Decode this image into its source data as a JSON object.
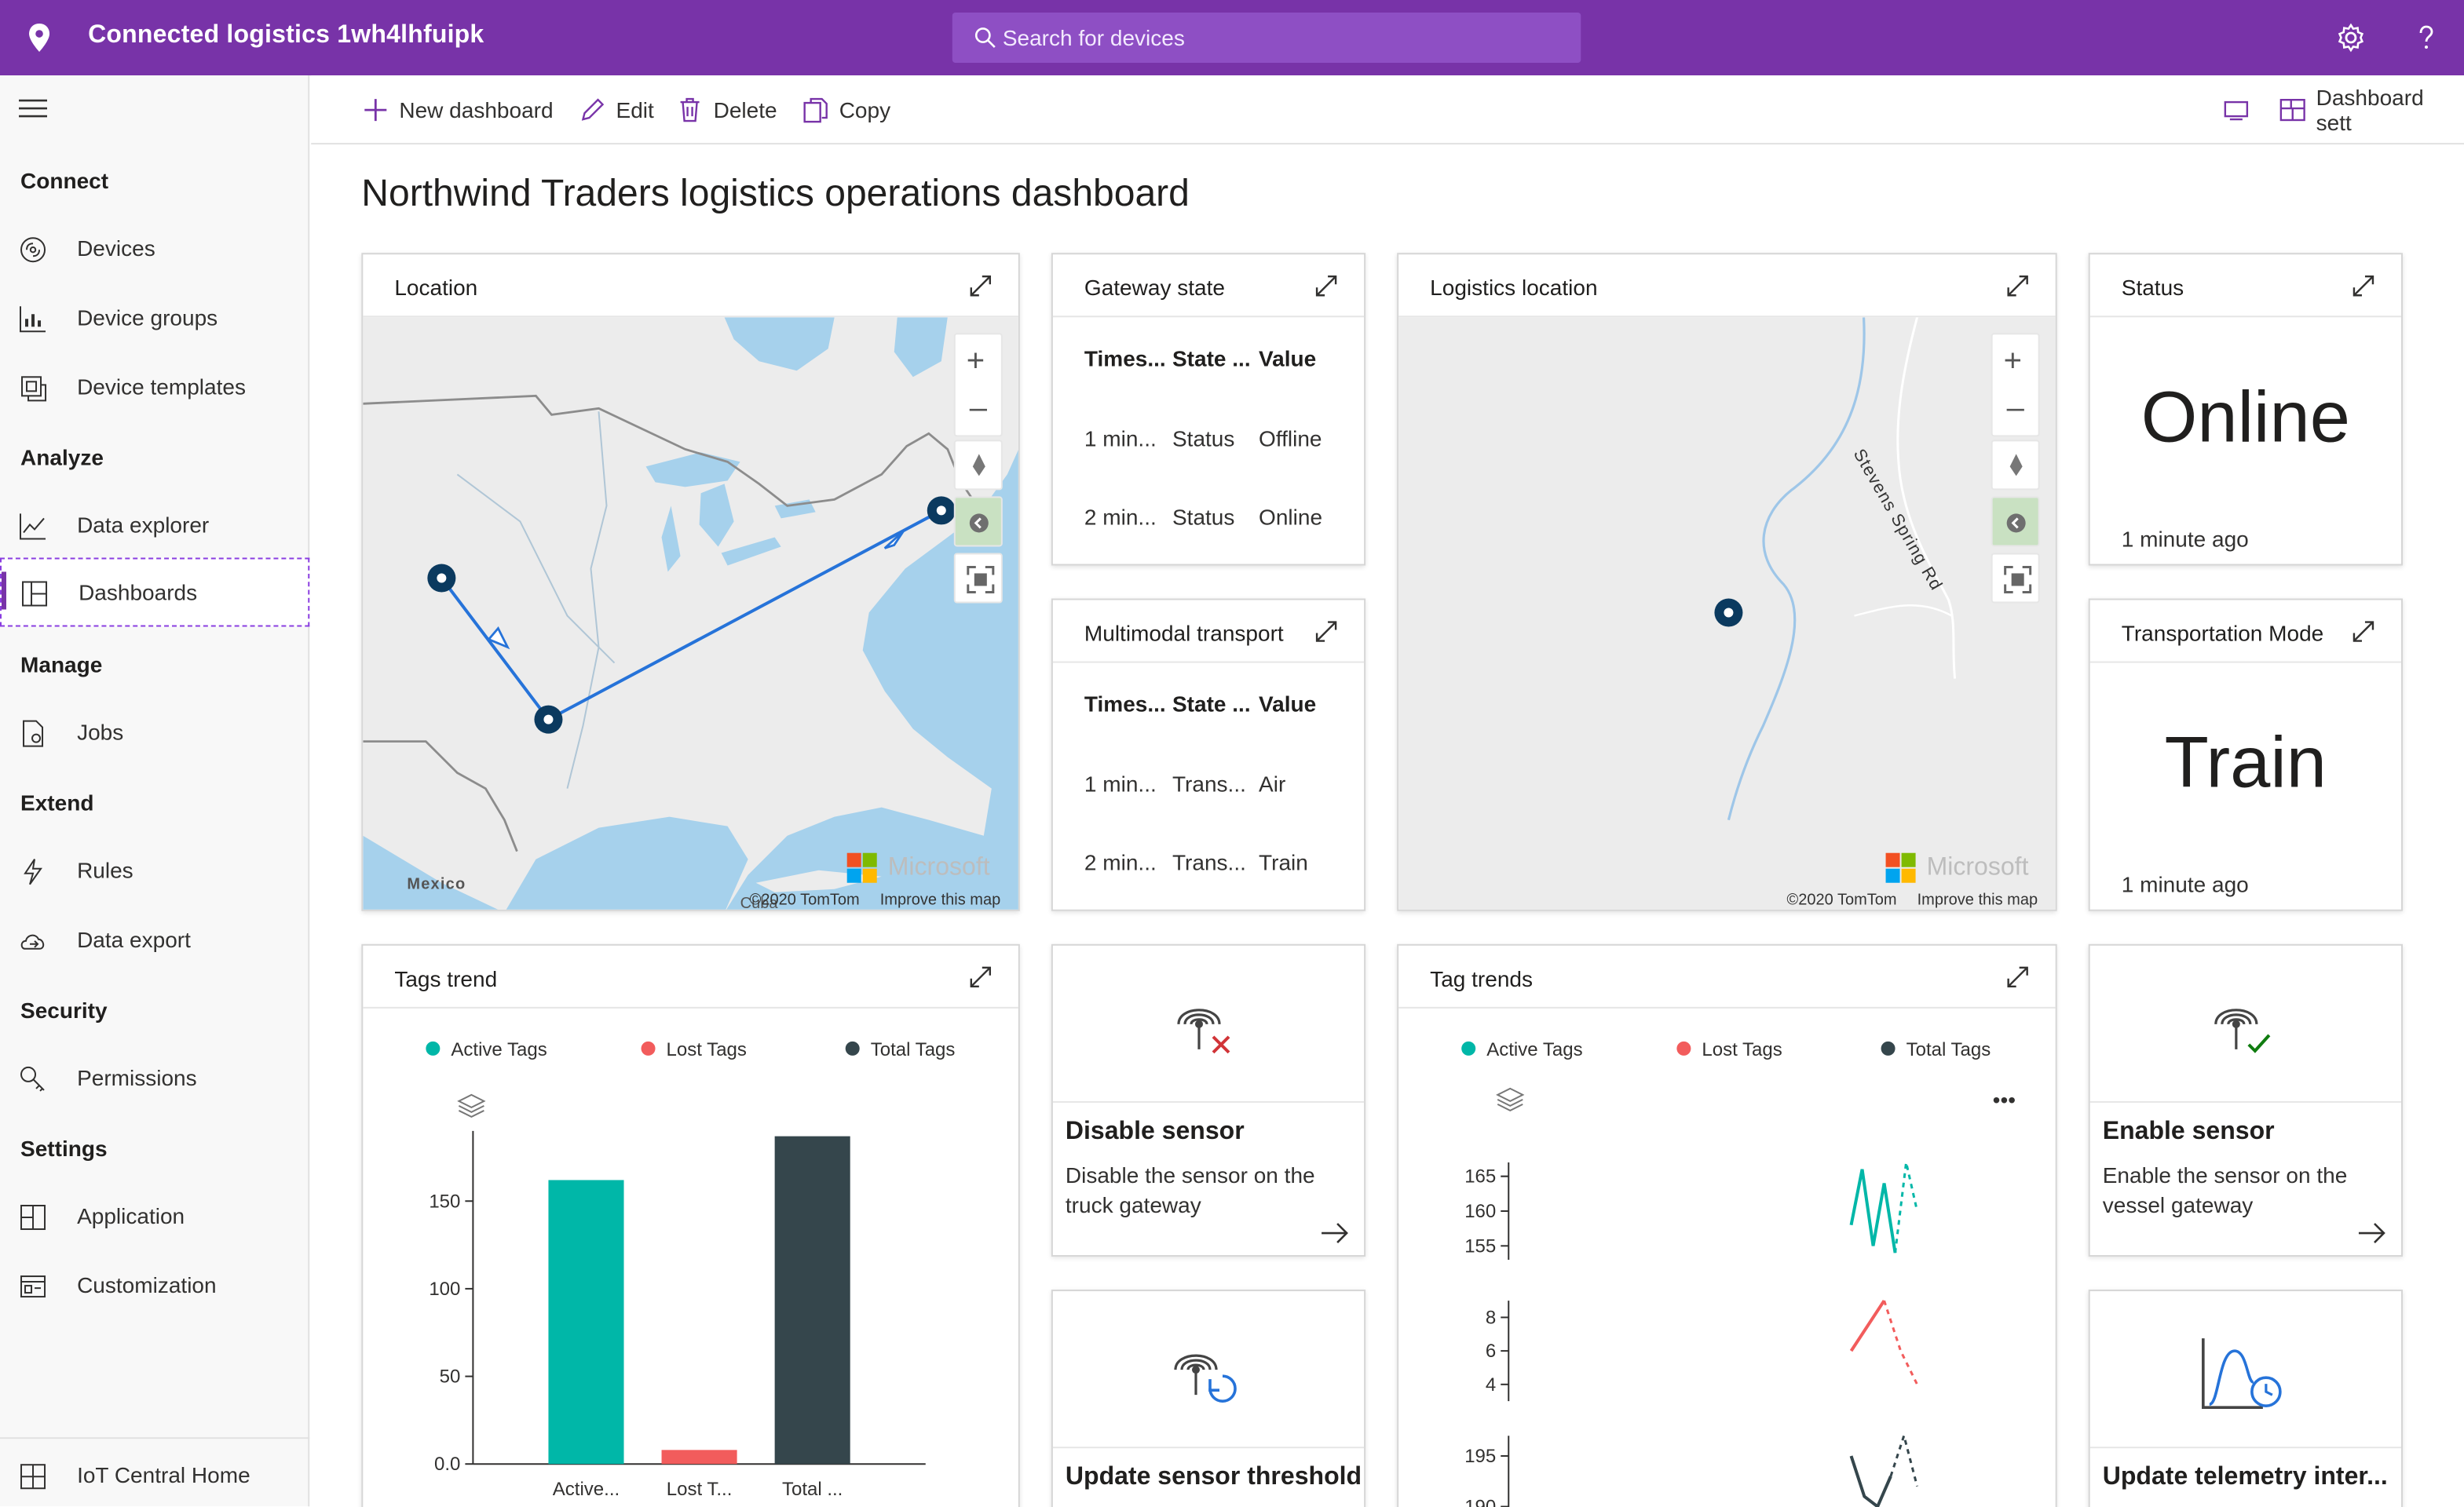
{
  "app": {
    "title": "Connected logistics 1wh4lhfuipk"
  },
  "search": {
    "placeholder": "Search for devices"
  },
  "toolbar": {
    "new_dashboard": "New dashboard",
    "edit": "Edit",
    "delete": "Delete",
    "copy": "Copy",
    "dashboard_settings": "Dashboard sett"
  },
  "sidebar": {
    "sections": {
      "connect": "Connect",
      "analyze": "Analyze",
      "manage": "Manage",
      "extend": "Extend",
      "security": "Security",
      "settings": "Settings"
    },
    "items": {
      "devices": "Devices",
      "device_groups": "Device groups",
      "device_templates": "Device templates",
      "data_explorer": "Data explorer",
      "dashboards": "Dashboards",
      "jobs": "Jobs",
      "rules": "Rules",
      "data_export": "Data export",
      "permissions": "Permissions",
      "application": "Application",
      "customization": "Customization",
      "iot_home": "IoT Central Home"
    },
    "active": "Dashboards"
  },
  "page": {
    "title": "Northwind Traders logistics operations dashboard"
  },
  "tiles": {
    "location": {
      "title": "Location",
      "label_mexico": "Mexico",
      "label_cuba": "Cuba",
      "credit": "©2020 TomTom",
      "improve": "Improve this map",
      "brand": "Microsoft"
    },
    "gateway_state": {
      "title": "Gateway state",
      "columns": [
        "Times...",
        "State ...",
        "Value"
      ],
      "rows": [
        [
          "1 min...",
          "Status",
          "Offline"
        ],
        [
          "2 min...",
          "Status",
          "Online"
        ]
      ]
    },
    "multimodal": {
      "title": "Multimodal transport",
      "columns": [
        "Times...",
        "State ...",
        "Value"
      ],
      "rows": [
        [
          "1 min...",
          "Trans...",
          "Air"
        ],
        [
          "2 min...",
          "Trans...",
          "Train"
        ]
      ]
    },
    "logistics_location": {
      "title": "Logistics location",
      "road": "Stevens Spring Rd",
      "credit": "©2020 TomTom",
      "improve": "Improve this map",
      "brand": "Microsoft"
    },
    "status": {
      "title": "Status",
      "value": "Online",
      "ago": "1 minute ago"
    },
    "transport_mode": {
      "title": "Transportation Mode",
      "value": "Train",
      "ago": "1 minute ago"
    },
    "tags_trend": {
      "title": "Tags trend"
    },
    "disable_sensor": {
      "title": "Disable sensor",
      "desc_line1": "Disable the sensor on the",
      "desc_line2": "truck gateway"
    },
    "update_threshold": {
      "title": "Update sensor threshold"
    },
    "tag_trends": {
      "title": "Tag trends",
      "more": "•••"
    },
    "enable_sensor": {
      "title": "Enable sensor",
      "desc_line1": "Enable the sensor on the",
      "desc_line2": "vessel gateway"
    },
    "update_telemetry": {
      "title": "Update telemetry inter..."
    }
  },
  "colors": {
    "brand": "#7833a8",
    "active": "#00b7a8",
    "lost": "#f25c5c",
    "total": "#35464c",
    "route": "#2673d9"
  },
  "chart_data": [
    {
      "type": "bar",
      "categories": [
        "Active...",
        "Lost T...",
        "Total ..."
      ],
      "series": [
        {
          "name": "Active Tags",
          "values": [
            162,
            null,
            null
          ]
        },
        {
          "name": "Lost Tags",
          "values": [
            null,
            8,
            null
          ]
        },
        {
          "name": "Total Tags",
          "values": [
            null,
            null,
            187
          ]
        }
      ],
      "legend": [
        "Active Tags",
        "Lost Tags",
        "Total Tags"
      ],
      "values": [
        162,
        8,
        187
      ],
      "yticks": [
        "0.0",
        "50",
        "100",
        "150"
      ],
      "ylim": [
        0,
        190
      ]
    },
    {
      "type": "line",
      "legend": [
        "Active Tags",
        "Lost Tags",
        "Total Tags"
      ],
      "panels": [
        {
          "series": "Active Tags",
          "yticks": [
            "155",
            "160",
            "165"
          ],
          "ylim": [
            153,
            167
          ],
          "values": [
            158,
            166,
            155,
            164,
            154,
            167,
            160
          ]
        },
        {
          "series": "Lost Tags",
          "yticks": [
            "4",
            "6",
            "8"
          ],
          "ylim": [
            3,
            9
          ],
          "values": [
            6,
            7.5,
            9,
            6,
            4
          ]
        },
        {
          "series": "Total Tags",
          "yticks": [
            "190",
            "195"
          ],
          "ylim": [
            188,
            197
          ],
          "values": [
            195,
            191,
            190,
            193,
            197,
            192
          ]
        }
      ]
    }
  ]
}
